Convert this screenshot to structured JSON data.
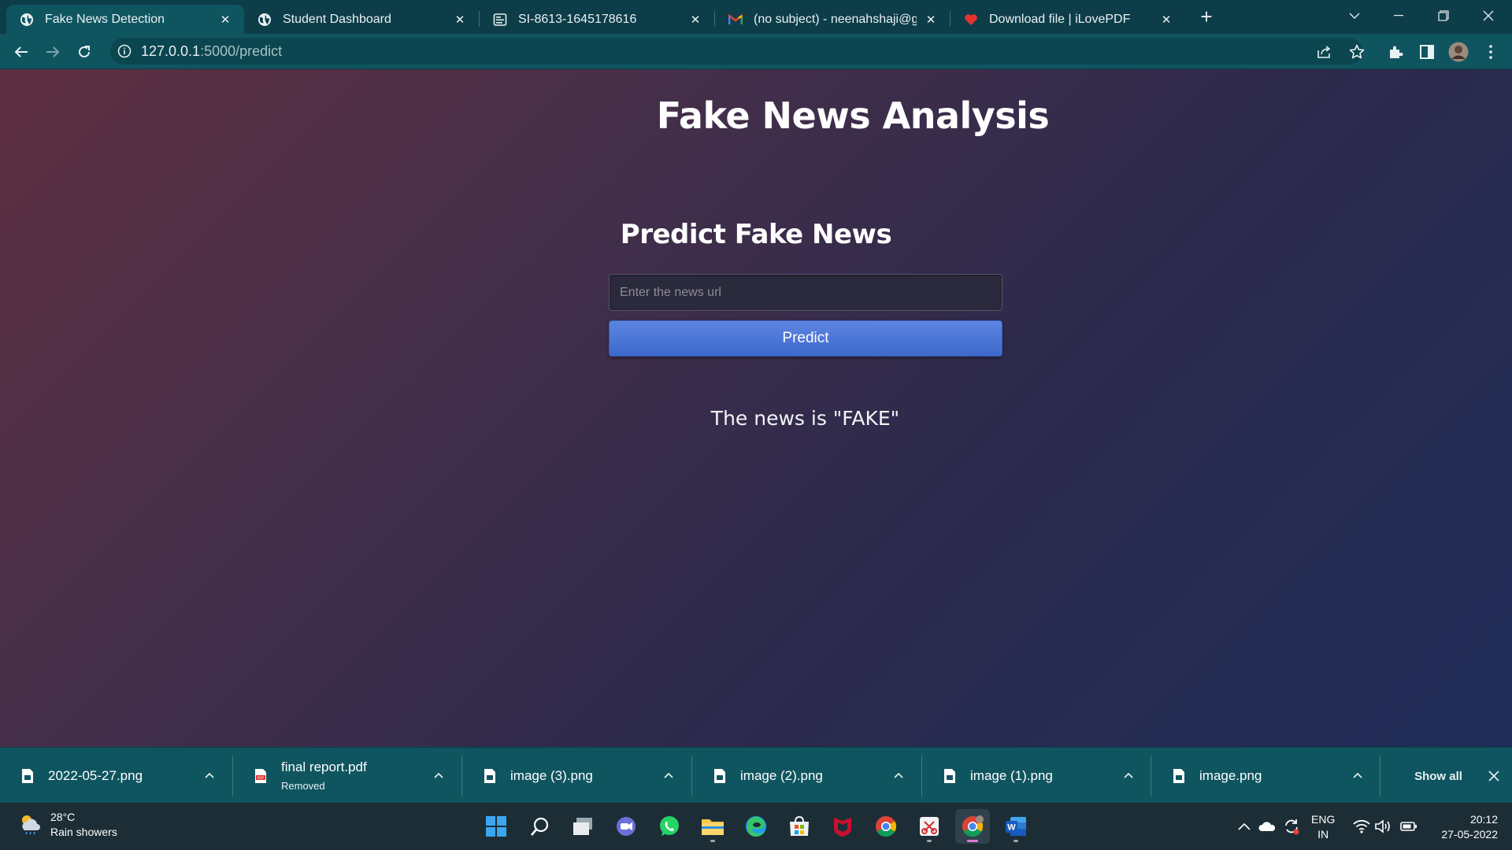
{
  "browser": {
    "tabs": [
      {
        "title": "Fake News Detection",
        "icon": "globe-icon",
        "active": true
      },
      {
        "title": "Student Dashboard",
        "icon": "globe-icon",
        "active": false
      },
      {
        "title": "SI-8613-1645178616",
        "icon": "document-icon",
        "active": false
      },
      {
        "title": "(no subject) - neenahshaji@gmail.com",
        "icon": "gmail-icon",
        "active": false
      },
      {
        "title": "Download file | iLovePDF",
        "icon": "heart-icon",
        "active": false
      }
    ],
    "url_host": "127.0.0.1",
    "url_path": ":5000/predict"
  },
  "page": {
    "title": "Fake News Analysis",
    "form_title": "Predict Fake News",
    "input_placeholder": "Enter the news url",
    "input_value": "",
    "button_label": "Predict",
    "result_text": "The news is \"FAKE\""
  },
  "downloads": {
    "items": [
      {
        "name": "2022-05-27.png",
        "status": "",
        "icon": "image-file-icon"
      },
      {
        "name": "final report.pdf",
        "status": "Removed",
        "icon": "pdf-file-icon"
      },
      {
        "name": "image (3).png",
        "status": "",
        "icon": "image-file-icon"
      },
      {
        "name": "image (2).png",
        "status": "",
        "icon": "image-file-icon"
      },
      {
        "name": "image (1).png",
        "status": "",
        "icon": "image-file-icon"
      },
      {
        "name": "image.png",
        "status": "",
        "icon": "image-file-icon"
      }
    ],
    "show_all_label": "Show all"
  },
  "taskbar": {
    "weather_temp": "28°C",
    "weather_desc": "Rain showers",
    "lang_primary": "ENG",
    "lang_secondary": "IN",
    "time": "20:12",
    "date": "27-05-2022"
  },
  "colors": {
    "chrome_frame": "#0d3d49",
    "chrome_toolbar": "#0f5560",
    "button_blue": "#4a77d6",
    "page_gradient_start": "#5e2f40",
    "page_gradient_end": "#1f2d58"
  }
}
